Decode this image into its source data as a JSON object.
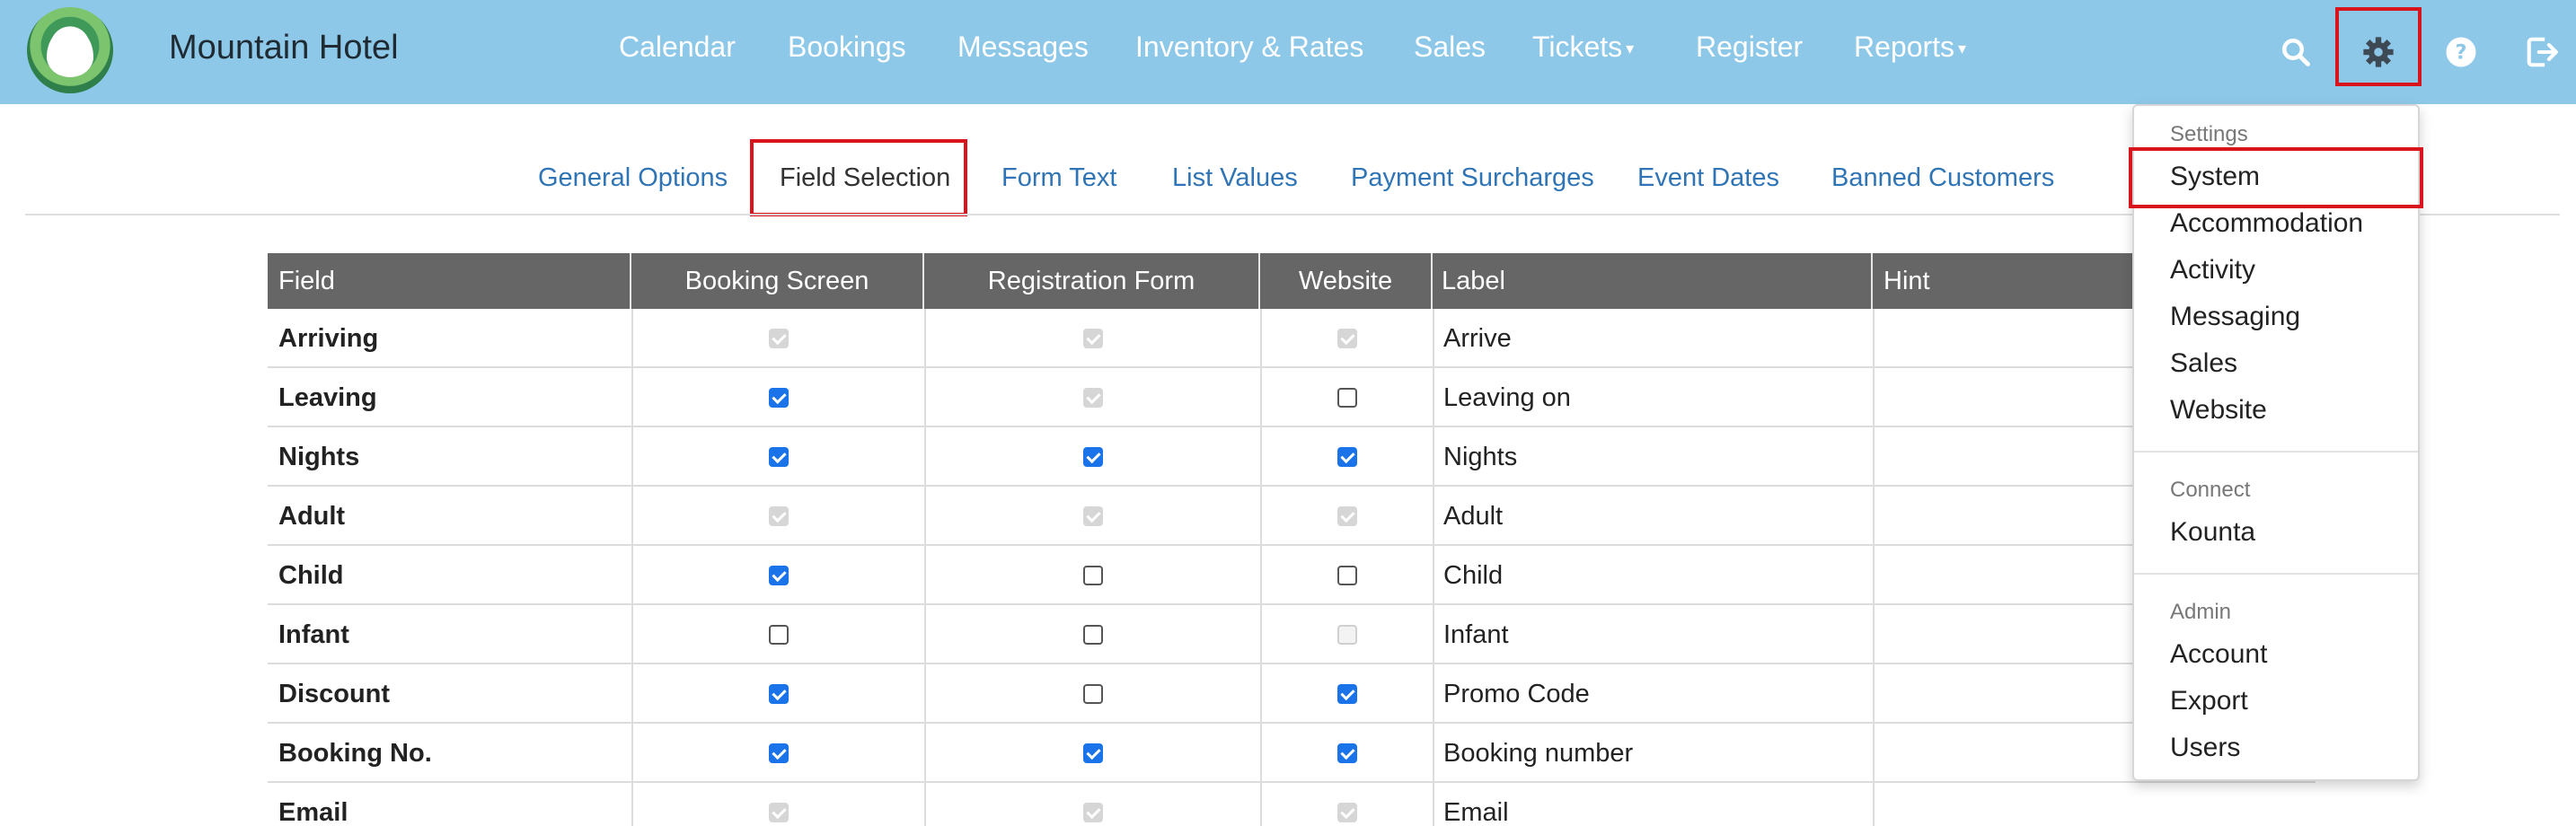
{
  "header": {
    "brand": "Mountain Hotel",
    "nav": [
      "Calendar",
      "Bookings",
      "Messages",
      "Inventory & Rates",
      "Sales",
      "Tickets",
      "Register",
      "Reports"
    ],
    "caret": "▾"
  },
  "tabs": [
    "General Options",
    "Field Selection",
    "Form Text",
    "List Values",
    "Payment Surcharges",
    "Event Dates",
    "Banned Customers"
  ],
  "table": {
    "headers": [
      "Field",
      "Booking Screen",
      "Registration Form",
      "Website",
      "Label",
      "Hint"
    ],
    "rows": [
      {
        "field": "Arriving",
        "booking": "disabled",
        "registration": "disabled",
        "website": "disabled",
        "label": "Arrive"
      },
      {
        "field": "Leaving",
        "booking": "checked",
        "registration": "disabled",
        "website": "unchecked",
        "label": "Leaving on"
      },
      {
        "field": "Nights",
        "booking": "checked",
        "registration": "checked",
        "website": "checked",
        "label": "Nights"
      },
      {
        "field": "Adult",
        "booking": "disabled",
        "registration": "disabled",
        "website": "disabled",
        "label": "Adult"
      },
      {
        "field": "Child",
        "booking": "checked",
        "registration": "unchecked",
        "website": "unchecked",
        "label": "Child"
      },
      {
        "field": "Infant",
        "booking": "unchecked",
        "registration": "unchecked",
        "website": "disabled-empty",
        "label": "Infant"
      },
      {
        "field": "Discount",
        "booking": "checked",
        "registration": "unchecked",
        "website": "checked",
        "label": "Promo Code"
      },
      {
        "field": "Booking No.",
        "booking": "checked",
        "registration": "checked",
        "website": "checked",
        "label": "Booking number"
      },
      {
        "field": "Email",
        "booking": "disabled",
        "registration": "disabled",
        "website": "disabled",
        "label": "Email"
      }
    ]
  },
  "dropdown": {
    "sections": [
      {
        "heading": "Settings",
        "items": [
          "System",
          "Accommodation",
          "Activity",
          "Messaging",
          "Sales",
          "Website"
        ]
      },
      {
        "heading": "Connect",
        "items": [
          "Kounta"
        ]
      },
      {
        "heading": "Admin",
        "items": [
          "Account",
          "Export",
          "Users"
        ]
      }
    ]
  },
  "colors": {
    "topbar": "#8ec8e8",
    "highlight": "#d8141c",
    "link": "#2f74b5",
    "checkbox": "#1a73e8",
    "header_row": "#666666"
  }
}
